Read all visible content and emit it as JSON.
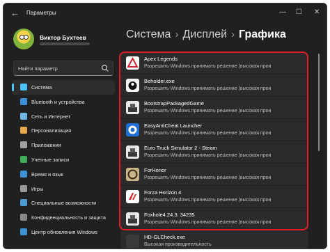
{
  "window": {
    "back_icon": "arrow-left-icon",
    "title": "Параметры",
    "controls": {
      "minimize": "—",
      "maximize": "☐",
      "close": "✕"
    }
  },
  "user": {
    "name": "Виктор Бухтеев",
    "avatar_icon": "simpsons-avatar"
  },
  "search": {
    "placeholder": "Найти параметр",
    "icon": "search-icon"
  },
  "nav": {
    "items": [
      {
        "label": "Система",
        "icon": "monitor-icon",
        "color": "#4cc2ff",
        "active": true
      },
      {
        "label": "Bluetooth и устройства",
        "icon": "bluetooth-icon",
        "color": "#3a8fd8"
      },
      {
        "label": "Сеть и Интернет",
        "icon": "wifi-icon",
        "color": "#6fb8e6"
      },
      {
        "label": "Персонализация",
        "icon": "brush-icon",
        "color": "#e8a84b"
      },
      {
        "label": "Приложения",
        "icon": "apps-icon",
        "color": "#a0a0a0"
      },
      {
        "label": "Учетные записи",
        "icon": "user-icon",
        "color": "#3fae5a"
      },
      {
        "label": "Время и язык",
        "icon": "globe-clock-icon",
        "color": "#3b93d6"
      },
      {
        "label": "Игры",
        "icon": "gamepad-icon",
        "color": "#9a9a9a"
      },
      {
        "label": "Специальные возможности",
        "icon": "accessibility-icon",
        "color": "#4a9ad6"
      },
      {
        "label": "Конфиденциальность и защита",
        "icon": "shield-icon",
        "color": "#8a8a8a"
      },
      {
        "label": "Центр обновления Windows",
        "icon": "update-icon",
        "color": "#3b93d6"
      }
    ]
  },
  "breadcrumb": {
    "part1": "Система",
    "sep1": "›",
    "part2": "Дисплей",
    "sep2": "›",
    "current": "Графика"
  },
  "apps": [
    {
      "name": "Apex Legends",
      "desc": "Разрешить Windows принимать решение (высокая прои",
      "icon": "apex-legends-icon"
    },
    {
      "name": "Beholder.exe",
      "desc": "Разрешить Windows принимать решение (высокая прои",
      "icon": "beholder-icon"
    },
    {
      "name": "BootstrapPackagedGame",
      "desc": "Разрешить Windows принимать решение (высокая прои",
      "icon": "bootstrap-icon"
    },
    {
      "name": "EasyAntiCheat Launcher",
      "desc": "Разрешить Windows принимать решение (высокая прои",
      "icon": "easyanticheat-icon"
    },
    {
      "name": "Euro Truck Simulator 2 - Steam",
      "desc": "Разрешить Windows принимать решение (высокая прои",
      "icon": "eurotruck-icon"
    },
    {
      "name": "ForHonor",
      "desc": "Разрешить Windows принимать решение (высокая прои",
      "icon": "forhonor-icon"
    },
    {
      "name": "Forza Horizon 4",
      "desc": "Разрешить Windows принимать решение (высокая прои",
      "icon": "forza-icon"
    },
    {
      "name": "Foxhole4.24.3: 34235",
      "desc": "Разрешить Windows принимать решение (высокая прои",
      "icon": "foxhole-icon"
    },
    {
      "name": "HD-GLCheck.exe",
      "desc": "Высокая производительность",
      "icon": "hdglcheck-icon"
    }
  ],
  "highlight_color": "#e11d2a",
  "accent_color": "#4cc2ff"
}
